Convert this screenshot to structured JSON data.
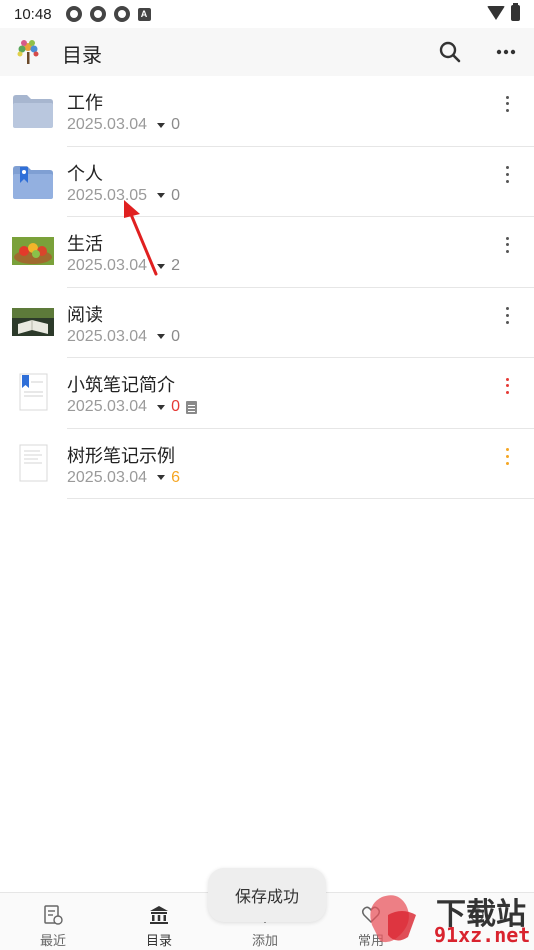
{
  "status_bar": {
    "time": "10:48"
  },
  "app_bar": {
    "title": "目录"
  },
  "items": [
    {
      "title": "工作",
      "date": "2025.03.04",
      "count": "0",
      "count_style": "grey",
      "icon": "folder-icon"
    },
    {
      "title": "个人",
      "date": "2025.03.05",
      "count": "0",
      "count_style": "grey",
      "icon": "bookmark-folder-icon"
    },
    {
      "title": "生活",
      "date": "2025.03.04",
      "count": "2",
      "count_style": "grey",
      "icon": "fruit-thumbnail-icon"
    },
    {
      "title": "阅读",
      "date": "2025.03.04",
      "count": "0",
      "count_style": "grey",
      "icon": "reading-thumbnail-icon"
    },
    {
      "title": "小筑笔记简介",
      "date": "2025.03.04",
      "count": "0",
      "count_style": "red",
      "icon": "bookmark-document-icon"
    },
    {
      "title": "树形笔记示例",
      "date": "2025.03.04",
      "count": "6",
      "count_style": "orange",
      "icon": "document-icon"
    }
  ],
  "bottom_nav": [
    {
      "label": "最近",
      "icon": "recent-icon"
    },
    {
      "label": "目录",
      "icon": "catalog-icon"
    },
    {
      "label": "添加",
      "icon": "add-icon"
    },
    {
      "label": "常用",
      "icon": "favorite-icon"
    },
    {
      "label": "",
      "icon": "settings-icon"
    }
  ],
  "toast": {
    "text": "保存成功"
  },
  "watermark": {
    "top": "下载站",
    "bottom": "91xz.net"
  },
  "colors": {
    "accent_red": "#e53935",
    "accent_orange": "#f5a623",
    "folder_blue": "#9fb4d6"
  }
}
